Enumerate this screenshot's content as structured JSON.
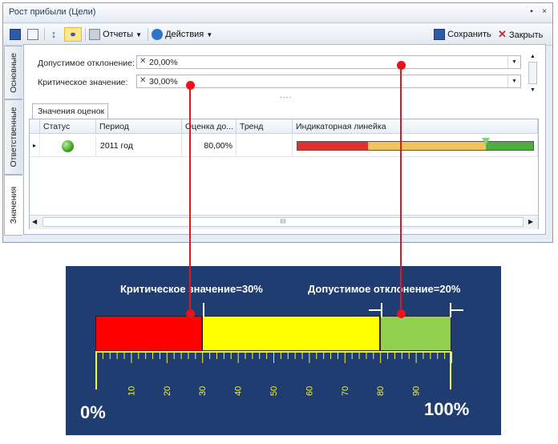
{
  "window": {
    "title": "Рост прибыли (Цели)",
    "min_icon": "▪",
    "close_icon": "×"
  },
  "toolbar": {
    "reports_label": "Отчеты",
    "actions_label": "Действия",
    "save_close_label": "Сохранить",
    "close_label": "Закрыть"
  },
  "side_tabs": [
    "Основные",
    "Ответственные",
    "Значения"
  ],
  "fields": {
    "allowed_label": "Допустимое отклонение:",
    "allowed_value": "20,00%",
    "critical_label": "Критическое значение:",
    "critical_value": "30,00%"
  },
  "grid": {
    "tab_label": "Значения оценок",
    "columns": [
      "Статус",
      "Период",
      "Оценка до...",
      "Тренд",
      "Индикаторная линейка"
    ],
    "rows": [
      {
        "status": "green",
        "period": "2011 год",
        "score": "80,00%",
        "trend": ""
      }
    ],
    "scroll_marker": "III"
  },
  "indicator": {
    "red_end": 30,
    "yellow_end": 80,
    "marker": 80,
    "colors": {
      "red": "#e03131",
      "yellow": "#f2c45a",
      "green": "#4caf3f"
    }
  },
  "diagram": {
    "critical_caption": "Критическое значение=30%",
    "allowed_caption": "Допустимое отклонение=20%",
    "min_label": "0%",
    "max_label": "100%",
    "tick_labels": [
      "10",
      "20",
      "30",
      "40",
      "50",
      "60",
      "70",
      "80",
      "90"
    ],
    "segments": [
      {
        "name": "critical",
        "from": 0,
        "to": 30,
        "color": "#ff0000"
      },
      {
        "name": "warning",
        "from": 30,
        "to": 80,
        "color": "#ffff00"
      },
      {
        "name": "ok",
        "from": 80,
        "to": 100,
        "color": "#92d050"
      }
    ],
    "tick_color": "#f2f23a"
  },
  "connector_color": "#e8141b"
}
